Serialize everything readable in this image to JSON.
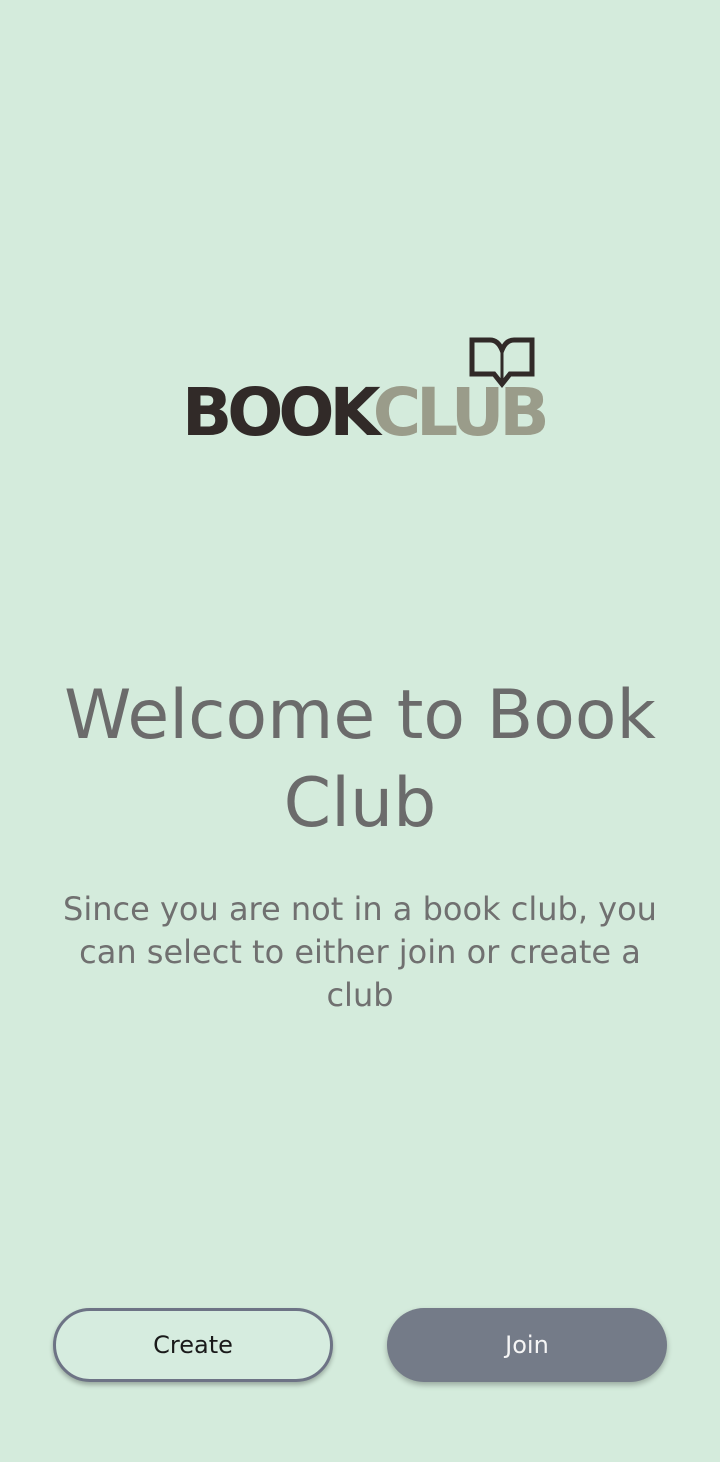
{
  "logo": {
    "part1": "BOOK",
    "part2": "CLUB",
    "icon": "open-book-icon",
    "colors": {
      "book": "#312a28",
      "club": "#9a9c8a"
    }
  },
  "welcome": {
    "title": "Welcome to Book Club",
    "subtitle": "Since you are not in a book club, you can select to either join or create a club"
  },
  "actions": {
    "create_label": "Create",
    "join_label": "Join"
  },
  "colors": {
    "background": "#d4ebdc",
    "join_button": "#747b88",
    "create_border": "#6d7385",
    "text_gray": "#6b6b6b"
  }
}
